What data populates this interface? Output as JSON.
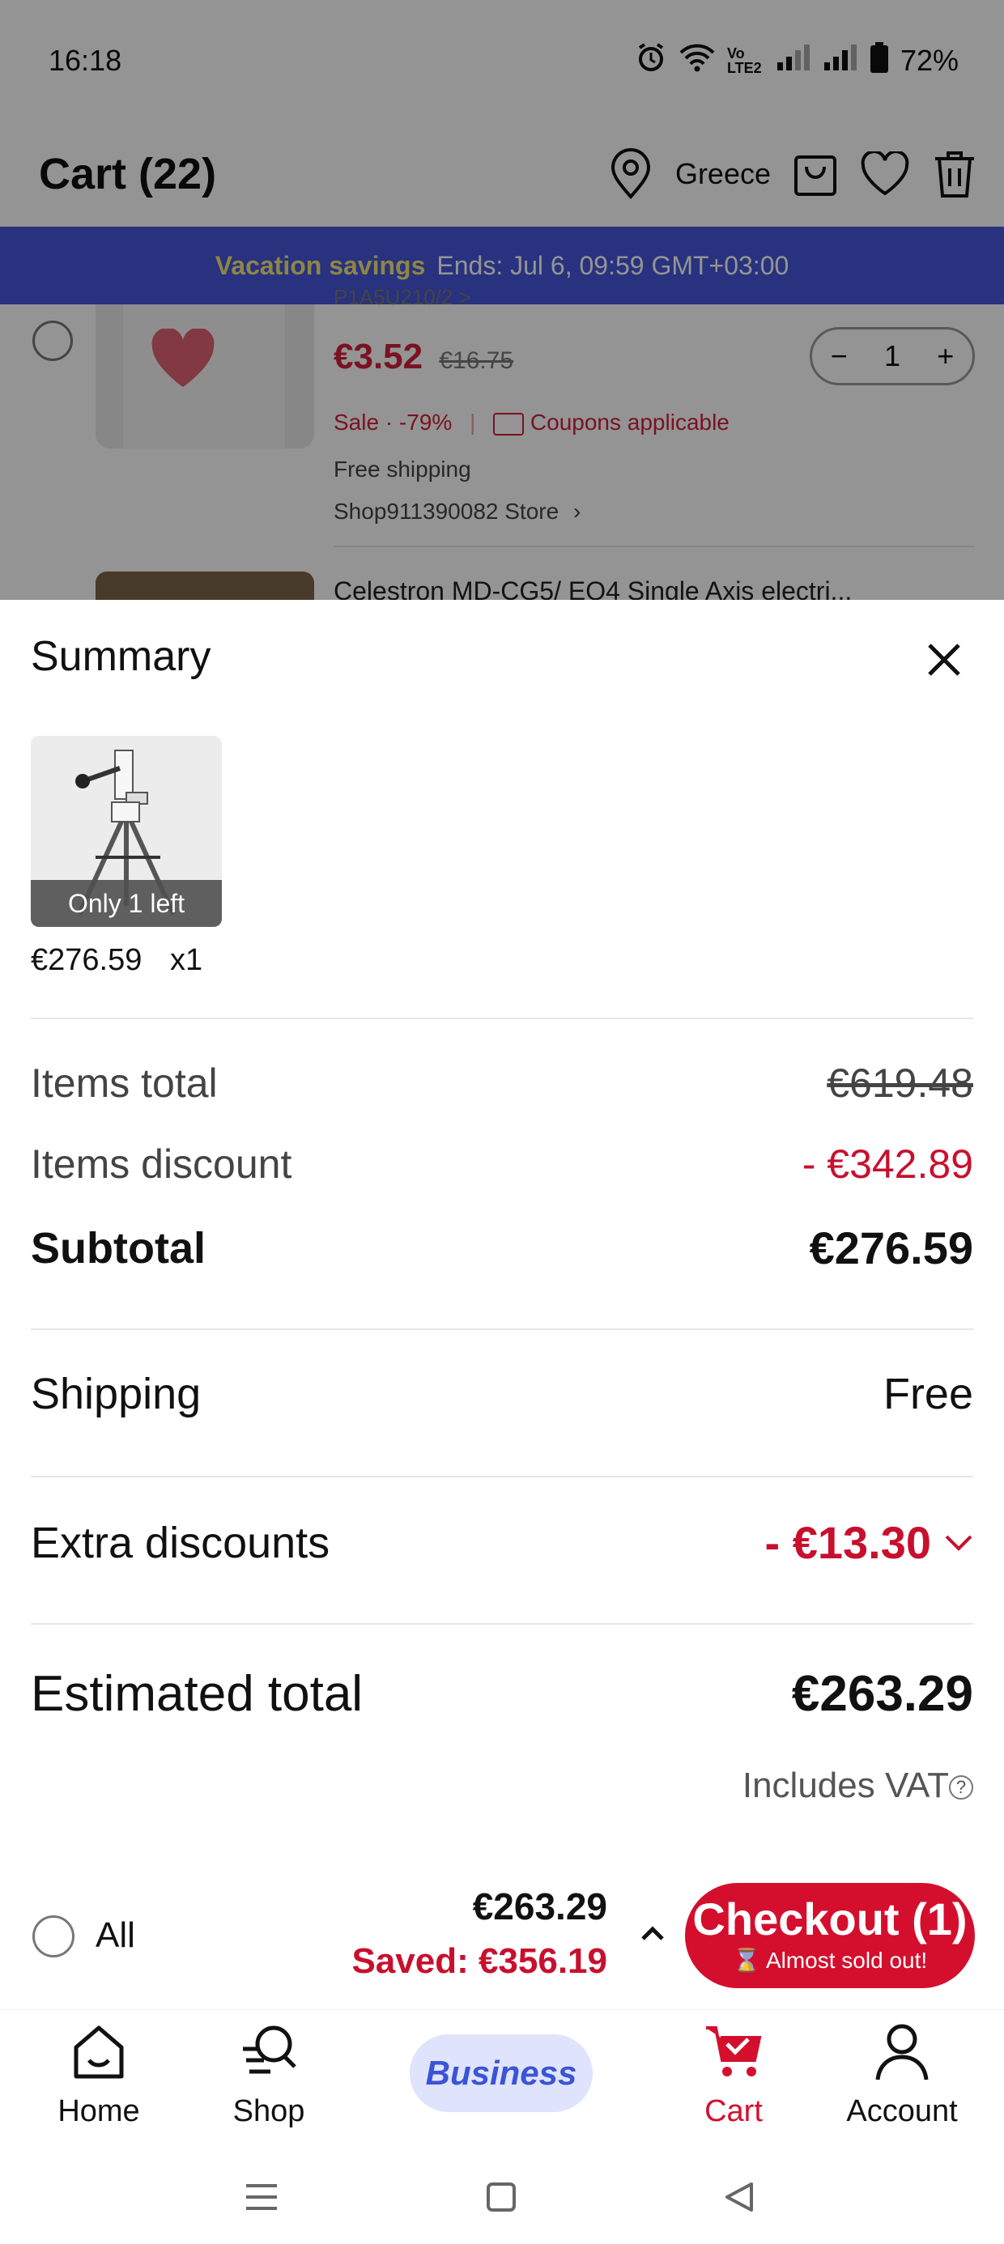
{
  "status": {
    "time": "16:18",
    "battery": "72%",
    "network": "Vo LTE2"
  },
  "header": {
    "title": "Cart (22)",
    "location": "Greece"
  },
  "promo": {
    "highlight": "Vacation savings",
    "text": "Ends: Jul 6, 09:59 GMT+03:00"
  },
  "background_items": [
    {
      "code": "P1A5U210/2 >",
      "price": "€3.52",
      "old_price": "€16.75",
      "quantity": "1",
      "sale": "Sale · -79%",
      "coupons": "Coupons applicable",
      "shipping": "Free shipping",
      "store": "Shop911390082 Store"
    },
    {
      "title": "Celestron MD-CG5/ EQ4 Single Axis electri..."
    }
  ],
  "summary": {
    "title": "Summary",
    "product": {
      "badge": "Only 1 left",
      "price": "€276.59",
      "qty": "x1"
    },
    "rows": [
      {
        "label": "Items total",
        "value": "€619.48"
      },
      {
        "label": "Items discount",
        "value": "- €342.89"
      },
      {
        "label": "Subtotal",
        "value": "€276.59"
      },
      {
        "label": "Shipping",
        "value": "Free"
      },
      {
        "label": "Extra discounts",
        "value": "- €13.30"
      },
      {
        "label": "Estimated total",
        "value": "€263.29"
      }
    ],
    "vat_note": "Includes VAT"
  },
  "checkout_bar": {
    "all_label": "All",
    "total": "€263.29",
    "saved": "Saved: €356.19",
    "button_label": "Checkout (1)",
    "button_sub": "Almost sold out!"
  },
  "nav": {
    "home": "Home",
    "shop": "Shop",
    "business": "Business",
    "cart": "Cart",
    "account": "Account"
  },
  "colors": {
    "accent_red": "#d40f2e",
    "banner_blue": "#4657d9",
    "business_blue": "#3b53d6"
  }
}
